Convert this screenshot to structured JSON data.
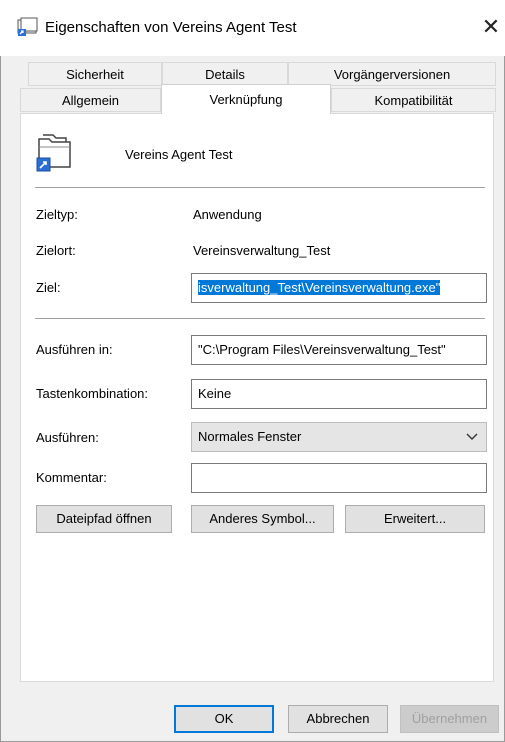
{
  "window": {
    "title": "Eigenschaften von Vereins Agent Test",
    "close_symbol": "✕"
  },
  "tabs": {
    "row1": [
      "Sicherheit",
      "Details",
      "Vorgängerversionen"
    ],
    "row2": [
      "Allgemein",
      "Verknüpfung",
      "Kompatibilität"
    ],
    "active": "Verknüpfung"
  },
  "shortcut": {
    "name": "Vereins Agent Test",
    "icon": "folder-shortcut-icon"
  },
  "fields": {
    "zieltyp_label": "Zieltyp:",
    "zieltyp_value": "Anwendung",
    "zielort_label": "Zielort:",
    "zielort_value": "Vereinsverwaltung_Test",
    "ziel_label": "Ziel:",
    "ziel_value": "isverwaltung_Test\\Vereinsverwaltung.exe\"",
    "ausfuehren_in_label": "Ausführen in:",
    "ausfuehren_in_value": "\"C:\\Program Files\\Vereinsverwaltung_Test\"",
    "tastenkombination_label": "Tastenkombination:",
    "tastenkombination_value": "Keine",
    "ausfuehren_label": "Ausführen:",
    "ausfuehren_value": "Normales Fenster",
    "kommentar_label": "Kommentar:",
    "kommentar_value": ""
  },
  "action_buttons": {
    "open_path": "Dateipfad öffnen",
    "change_icon": "Anderes Symbol...",
    "advanced": "Erweitert..."
  },
  "footer": {
    "ok": "OK",
    "cancel": "Abbrechen",
    "apply": "Übernehmen"
  },
  "colors": {
    "selection": "#0078d7",
    "dialog_bg": "#f0f0f0"
  }
}
